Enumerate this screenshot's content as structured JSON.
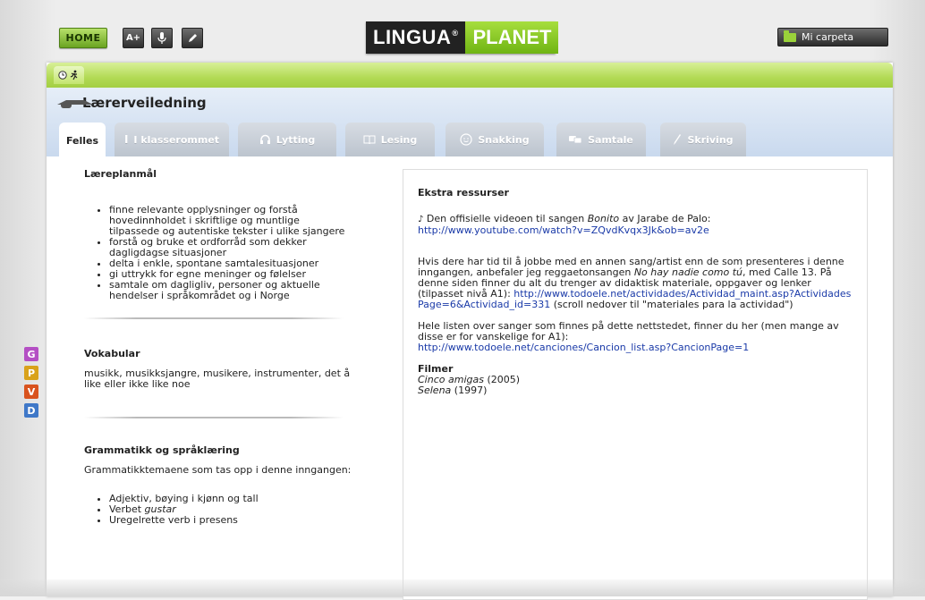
{
  "topbar": {
    "home_label": "HOME",
    "tool_buttons": [
      {
        "label": "A+",
        "icon": "text-size-icon"
      },
      {
        "label": "",
        "icon": "microphone-icon"
      },
      {
        "label": "",
        "icon": "pencil-icon"
      }
    ],
    "logo_part1": "LINGUA",
    "logo_mark": "®",
    "logo_part2": "PLANET",
    "folder_label": "Mi carpeta"
  },
  "colors": {
    "accent_green": "#8cc63f",
    "link": "#1a3aa8",
    "header_blue": "#c9d9ee"
  },
  "page": {
    "heading": "Lærerveiledning"
  },
  "tabs": [
    {
      "label": "Felles",
      "icon": "",
      "active": true
    },
    {
      "label": "I klasserommet",
      "icon": "classroom-icon",
      "active": false
    },
    {
      "label": "Lytting",
      "icon": "headphones-icon",
      "active": false
    },
    {
      "label": "Lesing",
      "icon": "book-icon",
      "active": false
    },
    {
      "label": "Snakking",
      "icon": "speech-icon",
      "active": false
    },
    {
      "label": "Samtale",
      "icon": "chat-icon",
      "active": false
    },
    {
      "label": "Skriving",
      "icon": "pen-icon",
      "active": false
    }
  ],
  "left": {
    "laereplan_title": "Læreplanmål",
    "laereplan_items": [
      "finne relevante opplysninger og forstå hovedinnholdet i skriftlige og muntlige tilpassede og autentiske tekster i ulike sjangere",
      "forstå og bruke et ordforråd som dekker dagligdagse situasjoner",
      "delta i enkle, spontane samtalesituasjoner",
      "gi uttrykk for egne meninger og følelser",
      "samtale om dagligliv, personer og aktuelle hendelser i språkområdet og i Norge"
    ],
    "vokabular_title": "Vokabular",
    "vokabular_text": "musikk, musikksjangre, musikere, instrumenter, det å like eller ikke like noe",
    "grammatikk_title": "Grammatikk og språklæring",
    "grammatikk_intro": "Grammatikktemaene som tas opp i denne inngangen:",
    "grammatikk_items": [
      {
        "pre": "Adjektiv, bøying i kjønn og tall",
        "em": ""
      },
      {
        "pre": "Verbet ",
        "em": "gustar"
      },
      {
        "pre": "Uregelrette verb i presens",
        "em": ""
      }
    ]
  },
  "right": {
    "title": "Ekstra ressurser",
    "p1_pre": " Den offisielle videoen til sangen ",
    "p1_em": "Bonito",
    "p1_post": " av Jarabe de Palo:",
    "p1_link": "http://www.youtube.com/watch?v=ZQvdKvqx3Jk&ob=av2e",
    "p2_pre": "Hvis dere har tid til å jobbe med en annen sang/artist enn de som presenteres i denne inngangen, anbefaler jeg reggaetonsangen ",
    "p2_em": "No hay nadie como tú",
    "p2_post": ", med Calle 13. På denne siden finner du alt du trenger av didaktisk materiale, oppgaver og lenker (tilpasset nivå A1):",
    "p2_link": "http://www.todoele.net/actividades/Actividad_maint.asp?ActividadesPage=6&Actividad_id=331",
    "p2_after": " (scroll nedover til \"materiales para la actividad\")",
    "p3_text": "Hele listen over sanger som finnes på dette nettstedet, finner du her (men mange av disse er for vanskelige for A1):",
    "p3_link": "http://www.todoele.net/canciones/Cancion_list.asp?CancionPage=1",
    "filmer_title": "Filmer",
    "films": [
      {
        "title": "Cinco amigas",
        "year": " (2005)"
      },
      {
        "title": "Selena",
        "year": " (1997)"
      }
    ]
  },
  "side_tabs": [
    {
      "label": "G",
      "color": "#b44fc4"
    },
    {
      "label": "P",
      "color": "#d9a21b"
    },
    {
      "label": "V",
      "color": "#d9531e"
    },
    {
      "label": "D",
      "color": "#3f78c8"
    }
  ]
}
